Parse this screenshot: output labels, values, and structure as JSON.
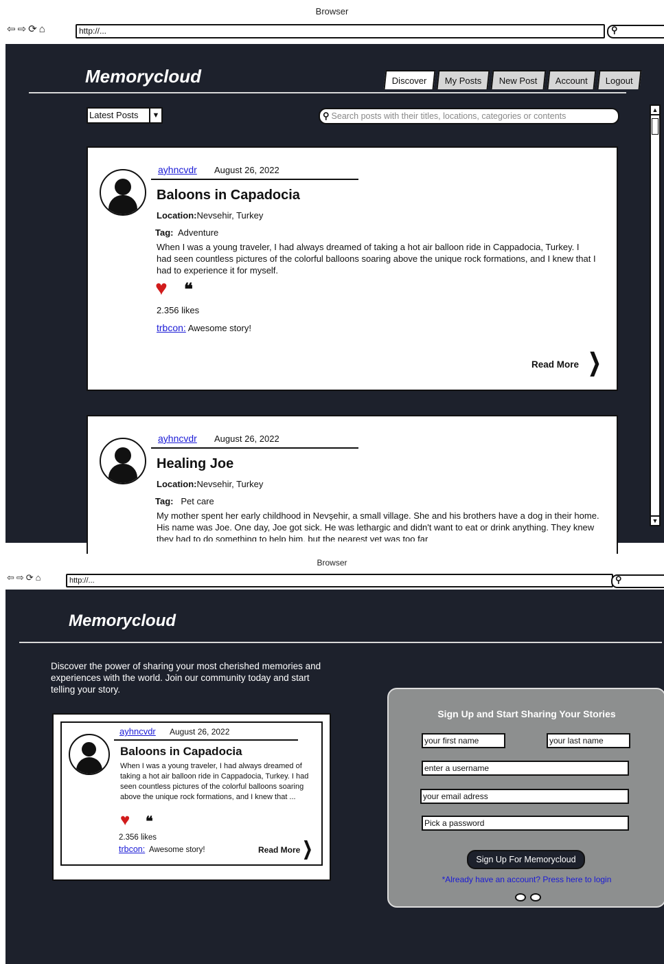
{
  "browser": {
    "title": "Browser",
    "url": "http://...",
    "nav_icons": "⇦⇨⟳⌂"
  },
  "discover": {
    "logo": "Memorycloud",
    "tabs": [
      "Discover",
      "My Posts",
      "New Post",
      "Account",
      "Logout"
    ],
    "active_tab": "Discover",
    "sort_select": "Latest Posts",
    "search_placeholder": "Search posts with their titles, locations, categories or contents",
    "posts": [
      {
        "author": "ayhncvdr",
        "date": "August 26, 2022",
        "title": "Baloons in Capadocia",
        "location_label": "Location:",
        "location": "Nevsehir, Turkey",
        "tag_label": "Tag:",
        "tag": "Adventure",
        "body": "When I was a young traveler, I had always dreamed of taking a hot air balloon ride in Cappadocia, Turkey. I had seen countless pictures of the colorful balloons soaring above the unique rock formations, and I knew that I had to experience it for myself.",
        "likes": "2.356 likes",
        "comment_author": "trbcon:",
        "comment": "Awesome story!",
        "read_more": "Read More"
      },
      {
        "author": "ayhncvdr",
        "date": "August 26, 2022",
        "title": "Healing Joe",
        "location_label": "Location:",
        "location": "Nevsehir, Turkey",
        "tag_label": "Tag:",
        "tag": "Pet care",
        "body": "My mother spent her early childhood in Nevşehir, a small village. She and his brothers have a dog in their home. His name was Joe. One day, Joe got sick. He was lethargic and didn't want to eat or drink anything. They knew they had to do something to help him, but the nearest vet was too far"
      }
    ]
  },
  "landing": {
    "logo": "Memorycloud",
    "intro": "Discover the power of sharing your most cherished memories and experiences with the world. Join our community today and start telling your story.",
    "preview": {
      "author": "ayhncvdr",
      "date": "August 26, 2022",
      "title": "Baloons in Capadocia",
      "body": "When I was a young traveler, I had always dreamed of taking a hot air balloon ride in Cappadocia, Turkey. I had seen countless pictures of the colorful balloons soaring above the unique rock formations, and I knew that ...",
      "likes": "2.356 likes",
      "comment_author": "trbcon:",
      "comment": "Awesome story!",
      "read_more": "Read More"
    },
    "signup": {
      "title": "Sign Up and Start Sharing Your Stories",
      "first_name": "your first name",
      "last_name": "your last name",
      "username": "enter a username",
      "email": "your email adress",
      "password": "Pick a password",
      "button": "Sign Up For Memorycloud",
      "login_link": "*Already have an account? Press here to login"
    }
  },
  "colors": {
    "background": "#1d212c",
    "panel": "#8d8f8f",
    "link": "#1a1ad6",
    "heart": "#d11b1b"
  }
}
